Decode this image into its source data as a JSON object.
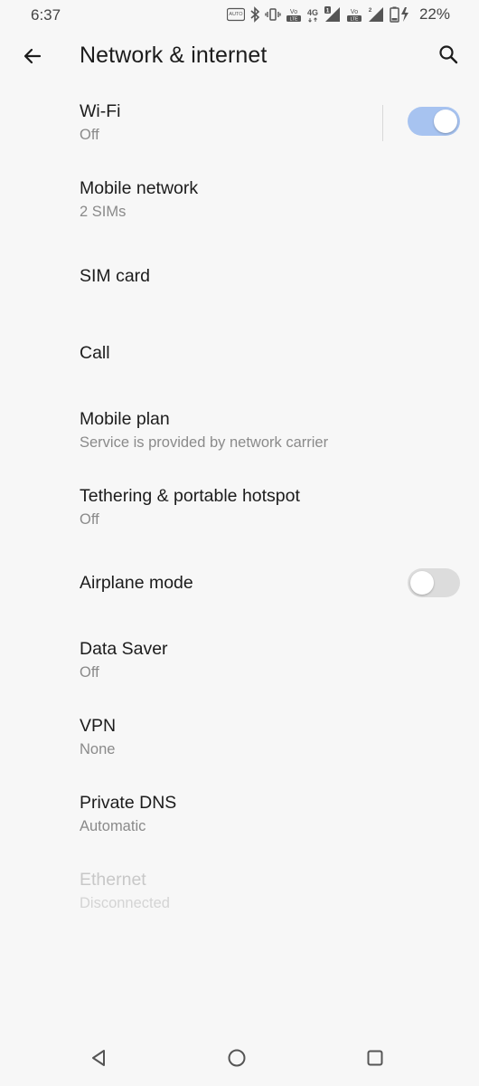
{
  "status_bar": {
    "time": "6:37",
    "battery_percent": "22%",
    "icons": [
      "auto-hd-icon",
      "bluetooth-icon",
      "vibrate-icon",
      "volte-icon",
      "4g-icon",
      "signal-sim1-icon",
      "volte-icon",
      "signal-sim2-icon",
      "battery-charging-icon"
    ],
    "badges": {
      "auto": "AUTO",
      "volte": "Vo",
      "lte": "LTE",
      "net": "4G",
      "sim1": "1",
      "sim2": "2"
    }
  },
  "header": {
    "title": "Network & internet",
    "back_icon": "arrow-back-icon",
    "search_icon": "search-icon"
  },
  "settings": {
    "wifi": {
      "title": "Wi-Fi",
      "subtitle": "Off",
      "toggle_on": true
    },
    "mobile_network": {
      "title": "Mobile network",
      "subtitle": "2 SIMs"
    },
    "sim_card": {
      "title": "SIM card"
    },
    "call": {
      "title": "Call"
    },
    "mobile_plan": {
      "title": "Mobile plan",
      "subtitle": "Service is provided by network carrier"
    },
    "tethering": {
      "title": "Tethering & portable hotspot",
      "subtitle": "Off"
    },
    "airplane_mode": {
      "title": "Airplane mode",
      "toggle_on": false
    },
    "data_saver": {
      "title": "Data Saver",
      "subtitle": "Off"
    },
    "vpn": {
      "title": "VPN",
      "subtitle": "None"
    },
    "private_dns": {
      "title": "Private DNS",
      "subtitle": "Automatic"
    },
    "ethernet": {
      "title": "Ethernet",
      "subtitle": "Disconnected",
      "enabled": false
    }
  },
  "colors": {
    "background": "#f7f7f7",
    "toggle_on_track": "#a7c3f0",
    "toggle_off_track": "#dcdcdc",
    "primary_text": "#1c1c1c",
    "secondary_text": "#8a8a8a"
  },
  "nav_bar": {
    "icons": [
      "nav-back-icon",
      "nav-home-icon",
      "nav-recents-icon"
    ]
  }
}
